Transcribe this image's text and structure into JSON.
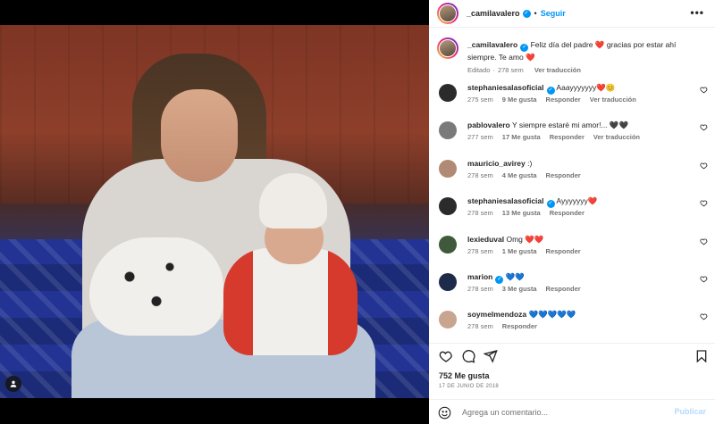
{
  "post": {
    "username": "_camilavalero",
    "follow_label": "Seguir",
    "more_label": "•••",
    "caption": "Feliz día del padre ❤️ gracias por estar ahí siempre. Te amo ❤️",
    "caption_meta": {
      "edited": "Editado",
      "time": "278 sem",
      "translate": "Ver traducción"
    },
    "likes": "752 Me gusta",
    "date": "17 DE JUNIO DE 2018",
    "comment_placeholder": "Agrega un comentario...",
    "publish_label": "Publicar"
  },
  "comments": [
    {
      "username": "stephaniesalasoficial",
      "verified": true,
      "text": "Aaayyyyyyy❤️😊",
      "time": "275 sem",
      "likes": "9 Me gusta",
      "reply": "Responder",
      "translate": "Ver traducción",
      "avatar_color": "#2b2b2b"
    },
    {
      "username": "pablovalero",
      "verified": false,
      "text": "Y siempre estaré mi amor!... 🖤🖤",
      "time": "277 sem",
      "likes": "17 Me gusta",
      "reply": "Responder",
      "translate": "Ver traducción",
      "avatar_color": "#7a7a7a"
    },
    {
      "username": "mauricio_avirey",
      "verified": false,
      "text": ":)",
      "time": "278 sem",
      "likes": "4 Me gusta",
      "reply": "Responder",
      "translate": "",
      "avatar_color": "#b08a74"
    },
    {
      "username": "stephaniesalasoficial",
      "verified": true,
      "text": "Ayyyyyyy❤️",
      "time": "278 sem",
      "likes": "13 Me gusta",
      "reply": "Responder",
      "translate": "",
      "avatar_color": "#2b2b2b"
    },
    {
      "username": "lexieduval",
      "verified": false,
      "text": "Omg ❤️❤️",
      "time": "278 sem",
      "likes": "1 Me gusta",
      "reply": "Responder",
      "translate": "",
      "avatar_color": "#3f5a3a"
    },
    {
      "username": "marion",
      "verified": true,
      "text": "💙💙",
      "time": "278 sem",
      "likes": "3 Me gusta",
      "reply": "Responder",
      "translate": "",
      "avatar_color": "#1e2a4a"
    },
    {
      "username": "soymelmendoza",
      "verified": false,
      "text": "💙💙💙💙💙",
      "time": "278 sem",
      "likes": "",
      "reply": "Responder",
      "translate": "",
      "avatar_color": "#c9a490"
    }
  ],
  "icons": {
    "like": "heart-icon",
    "comment": "comment-icon",
    "share": "share-icon",
    "save": "bookmark-icon",
    "emoji": "emoji-icon",
    "tag": "user-tag-icon"
  },
  "colors": {
    "accent": "#0095f6",
    "muted": "#737373",
    "text": "#262626",
    "publish_disabled": "#b3dbff"
  }
}
